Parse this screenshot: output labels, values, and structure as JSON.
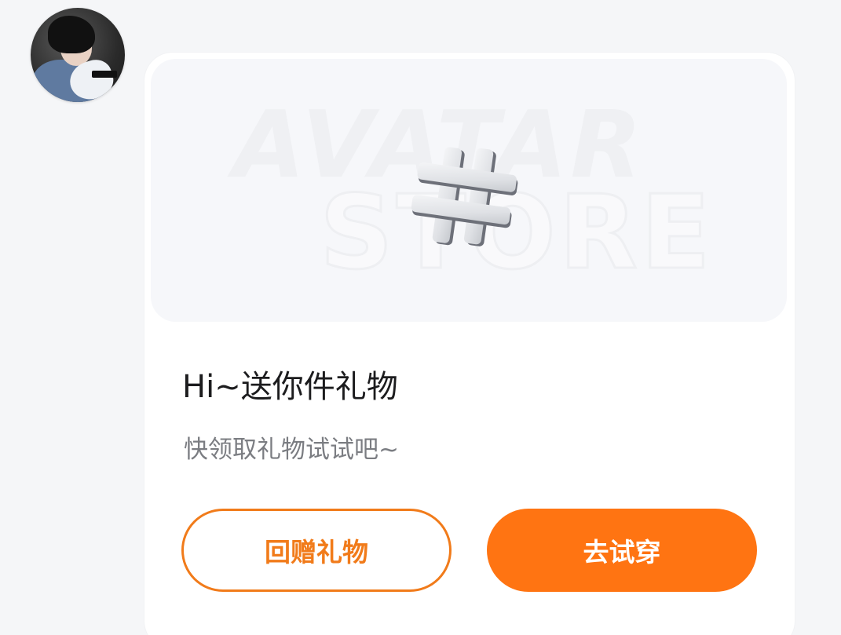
{
  "user": {
    "avatar_icon": "user-avatar-photo"
  },
  "banner": {
    "watermark_line1": "AVATAR",
    "watermark_line2": "STORE",
    "icon": "hash-icon"
  },
  "gift": {
    "title": "Hi~送你件礼物",
    "subtitle": "快领取礼物试试吧~"
  },
  "actions": {
    "return_gift_label": "回赠礼物",
    "try_on_label": "去试穿"
  },
  "colors": {
    "accent": "#ff7412",
    "outline": "#f17b1a",
    "background": "#f5f6f8",
    "card": "#ffffff"
  }
}
